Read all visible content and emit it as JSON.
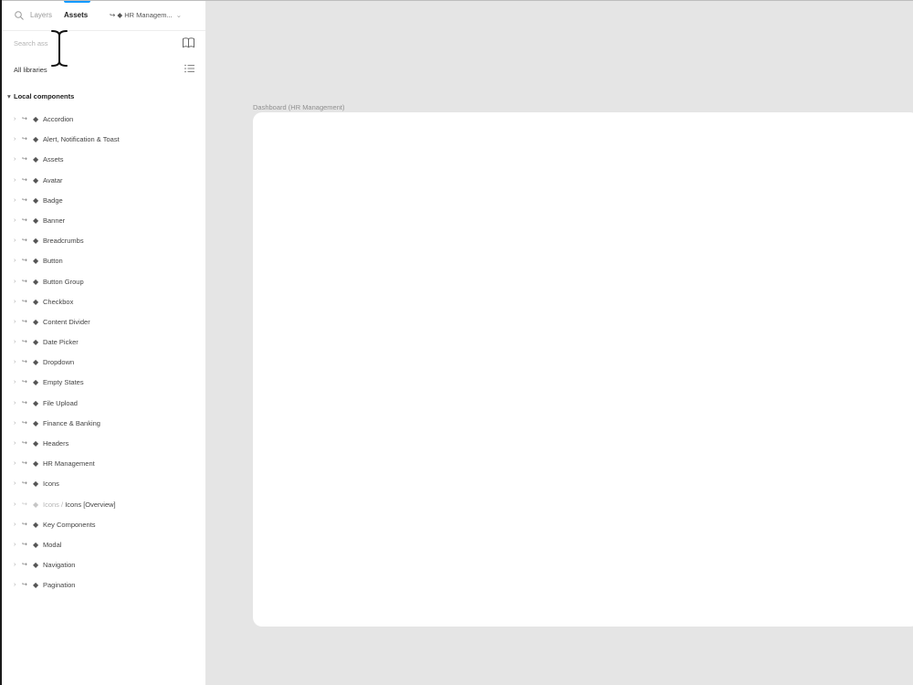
{
  "sidebar": {
    "tabs": {
      "layers": "Layers",
      "assets": "Assets",
      "library_picker": "↪ ◆ HR Managem..."
    },
    "search": {
      "placeholder": "Search ass",
      "value": ""
    },
    "all_libraries": "All libraries",
    "section_title": "Local components",
    "components": [
      {
        "label": "Accordion"
      },
      {
        "label": "Alert, Notification & Toast"
      },
      {
        "label": "Assets"
      },
      {
        "label": "Avatar"
      },
      {
        "label": "Badge"
      },
      {
        "label": "Banner"
      },
      {
        "label": "Breadcrumbs"
      },
      {
        "label": "Button"
      },
      {
        "label": "Button Group"
      },
      {
        "label": "Checkbox"
      },
      {
        "label": "Content Divider"
      },
      {
        "label": "Date Picker"
      },
      {
        "label": "Dropdown"
      },
      {
        "label": "Empty States"
      },
      {
        "label": "File Upload"
      },
      {
        "label": "Finance & Banking"
      },
      {
        "label": "Headers"
      },
      {
        "label": "HR Management"
      },
      {
        "label": "Icons"
      },
      {
        "label_muted": "Icons / ",
        "label": "Icons [Overview]",
        "dim": true
      },
      {
        "label": "Key Components"
      },
      {
        "label": "Modal"
      },
      {
        "label": "Navigation"
      },
      {
        "label": "Pagination"
      }
    ]
  },
  "canvas": {
    "frame_label": "Dashboard (HR Management)"
  },
  "icons": {
    "search": "search-icon",
    "book": "book-icon",
    "list_view": "list-view-icon",
    "chevron": "chevron-right-icon",
    "instance": "instance-icon",
    "component": "component-diamond-icon"
  },
  "colors": {
    "canvas_bg": "#e5e5e5",
    "panel_bg": "#ffffff",
    "accent": "#0d99ff"
  }
}
